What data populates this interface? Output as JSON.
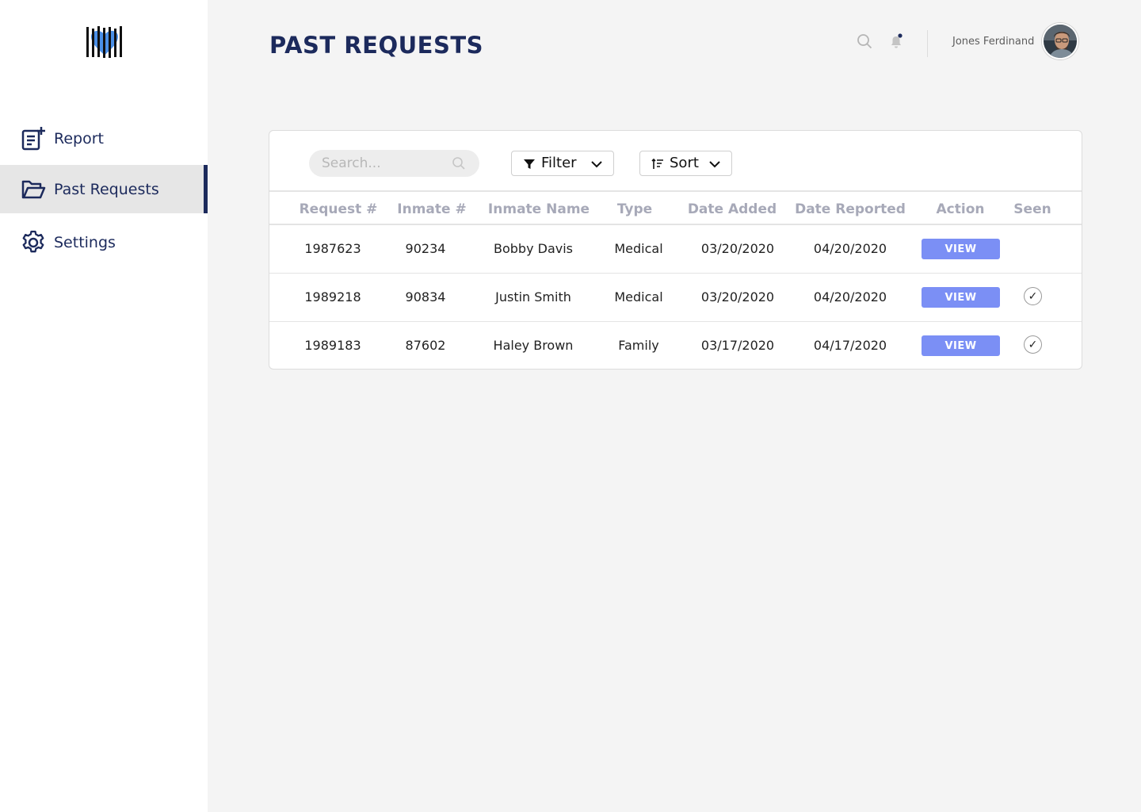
{
  "sidebar": {
    "items": [
      {
        "label": "Report",
        "icon": "report-add-icon"
      },
      {
        "label": "Past Requests",
        "icon": "folder-open-icon",
        "active": true
      },
      {
        "label": "Settings",
        "icon": "gear-icon"
      }
    ]
  },
  "header": {
    "title": "PAST REQUESTS",
    "user_name": "Jones Ferdinand"
  },
  "toolbar": {
    "search_placeholder": "Search...",
    "filter_label": "Filter",
    "sort_label": "Sort"
  },
  "table": {
    "columns": [
      "Request #",
      "Inmate #",
      "Inmate Name",
      "Type",
      "Date Added",
      "Date Reported",
      "Action",
      "Seen"
    ],
    "rows": [
      {
        "request": "1987623",
        "inmate": "90234",
        "name": "Bobby Davis",
        "type": "Medical",
        "added": "03/20/2020",
        "reported": "04/20/2020",
        "action": "VIEW",
        "seen": ""
      },
      {
        "request": "1989218",
        "inmate": "90834",
        "name": "Justin Smith",
        "type": "Medical",
        "added": "03/20/2020",
        "reported": "04/20/2020",
        "action": "VIEW",
        "seen": "✓"
      },
      {
        "request": "1989183",
        "inmate": "87602",
        "name": "Haley Brown",
        "type": "Family",
        "added": "03/17/2020",
        "reported": "04/17/2020",
        "action": "VIEW",
        "seen": "✓"
      }
    ]
  },
  "colors": {
    "brand": "#1c2a5c",
    "accent": "#7b8ff5",
    "logo_blue": "#4a8fe7"
  }
}
